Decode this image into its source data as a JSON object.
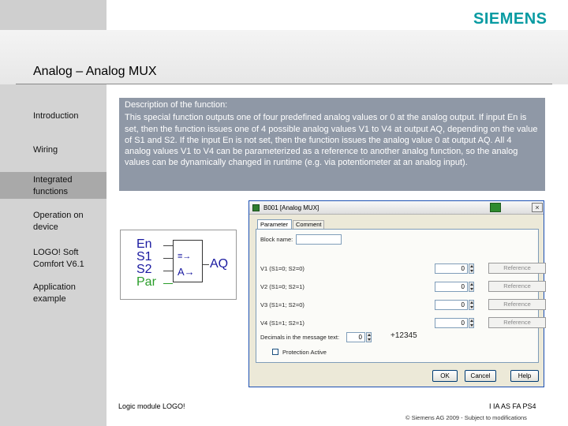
{
  "brand": {
    "logo_text": "SIEMENS",
    "accent": "#089ba2"
  },
  "page": {
    "title": "Analog – Analog MUX"
  },
  "nav": {
    "items": [
      {
        "label": "Introduction"
      },
      {
        "label": "Wiring"
      },
      {
        "label": "Integrated functions",
        "active": true
      },
      {
        "label": "Operation on device"
      },
      {
        "label": "LOGO! Soft Comfort V6.1"
      },
      {
        "label": "Application example"
      }
    ]
  },
  "description": {
    "heading": "Description of the function:",
    "body": "This special function outputs one of four predefined analog values or 0 at the analog output. If input En is set, then the function issues one of 4 possible analog values V1 to V4 at output AQ, depending on the value of S1 and S2. If the input En is not set, then the function issues the analog value 0 at output AQ. All 4 analog values V1 to V4 can be parameterized as a reference to another analog function, so the analog values can be dynamically changed in runtime (e.g. via potentiometer at an analog input)."
  },
  "dialog": {
    "title": "B001 [Analog MUX]",
    "tabs": [
      "Parameter",
      "Comment"
    ],
    "block_name_label": "Block name:",
    "rows": [
      {
        "label": "V1 (S1=0; S2=0)",
        "value": "0",
        "button": "Reference"
      },
      {
        "label": "V2 (S1=0; S2=1)",
        "value": "0",
        "button": "Reference"
      },
      {
        "label": "V3 (S1=1; S2=0)",
        "value": "0",
        "button": "Reference"
      },
      {
        "label": "V4 (S1=1; S2=1)",
        "value": "0",
        "button": "Reference"
      }
    ],
    "decimals_label": "Decimals in the message text:",
    "decimals_value": "0",
    "decimals_preview": "+12345",
    "protection_label": "Protection Active",
    "buttons": {
      "ok": "OK",
      "cancel": "Cancel",
      "help": "Help"
    }
  },
  "function_block": {
    "inputs": [
      "En",
      "S1",
      "S2",
      "Par"
    ],
    "output": "AQ",
    "pin_color": "#1a1aa0",
    "par_color": "#2a9d2a"
  },
  "footer": {
    "caption": "Logic module LOGO!",
    "dept": "I IA AS FA PS4",
    "copyright": "© Siemens AG 2009 - Subject to modifications"
  }
}
